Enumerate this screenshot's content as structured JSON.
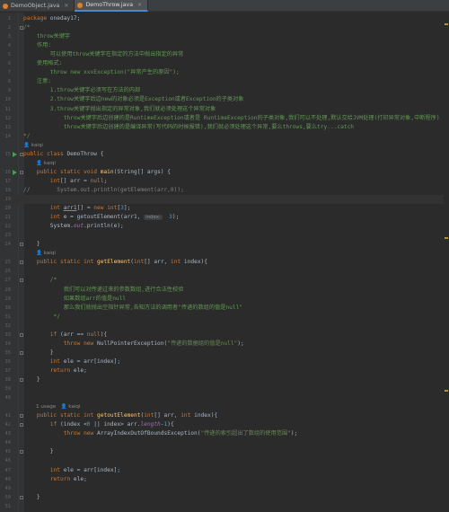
{
  "tabs": [
    {
      "label": "DemoObject.java",
      "active": false
    },
    {
      "label": "DemoThrow.java",
      "active": true
    }
  ],
  "colors": {
    "keyword": "#cc7832",
    "string": "#6a8759",
    "number": "#6897bb",
    "doc_comment": "#629755",
    "method": "#ffc66d",
    "field": "#9876aa"
  },
  "lines": [
    {
      "n": "1",
      "code": "package oneday17;"
    },
    {
      "n": "2",
      "code": "/*"
    },
    {
      "n": "3",
      "code": "    throw关键字"
    },
    {
      "n": "4",
      "code": "    作用:"
    },
    {
      "n": "5",
      "code": "        可以使用throw关键字在指定的方法中抛出指定的异常"
    },
    {
      "n": "6",
      "code": "    使用格式:"
    },
    {
      "n": "7",
      "code": "        throw new xxxException(\"异常产生的原因\");"
    },
    {
      "n": "8",
      "code": "    注意:"
    },
    {
      "n": "9",
      "code": "        1.throw关键字必须写在方法的内部"
    },
    {
      "n": "10",
      "code": "        2.throw关键字后边new的对象必须是Exception或者Exception的子类对象"
    },
    {
      "n": "11",
      "code": "        3.throw关键字抛出指定的异常对象,我们就必须处理这个异常对象"
    },
    {
      "n": "12",
      "code": "            throw关键字后边创建的是RuntimeException或者是 RuntimeException的子类对象,我们可以不处理,默认交给JVM处理(打印异常对象,中断程序)"
    },
    {
      "n": "13",
      "code": "            throw关键字后边创建的是编译异常(写代码的时候报错),我们就必须处理这个异常,要么throws,要么try...catch"
    },
    {
      "n": "14",
      "code": "*/"
    },
    {
      "n": "15",
      "code": "public class DemoThrow {"
    },
    {
      "n": "16",
      "code": "    public static void main(String[] args) {"
    },
    {
      "n": "17",
      "code": "        int[] arr = null;"
    },
    {
      "n": "18",
      "code": "//        System.out.println(getElement(arr,0));"
    },
    {
      "n": "19",
      "code": ""
    },
    {
      "n": "20",
      "code": "        int arr1[] = new int[3];"
    },
    {
      "n": "21",
      "code": "        int e = getoutElement(arr1,  3);"
    },
    {
      "n": "22",
      "code": "        System.out.println(e);"
    },
    {
      "n": "23",
      "code": ""
    },
    {
      "n": "24",
      "code": "    }"
    },
    {
      "n": "25",
      "code": "    public static int getElement(int[] arr, int index){"
    },
    {
      "n": "26",
      "code": ""
    },
    {
      "n": "27",
      "code": "        /*"
    },
    {
      "n": "28",
      "code": "            我们可以对传递过来的参数数组,进行合法性校验"
    },
    {
      "n": "29",
      "code": "            如果数组arr的值是null"
    },
    {
      "n": "30",
      "code": "            那么我们就抛出空指针异常,告知方法的调用者\"传递的数组的值是null\""
    },
    {
      "n": "31",
      "code": "         */"
    },
    {
      "n": "32",
      "code": ""
    },
    {
      "n": "33",
      "code": "        if (arr == null){"
    },
    {
      "n": "34",
      "code": "            throw new NullPointerException(\"传递的数据组的值是null\");"
    },
    {
      "n": "35",
      "code": "        }"
    },
    {
      "n": "36",
      "code": "        int ele = arr[index];"
    },
    {
      "n": "37",
      "code": "        return ele;"
    },
    {
      "n": "38",
      "code": "    }"
    },
    {
      "n": "39",
      "code": ""
    },
    {
      "n": "40",
      "code": ""
    },
    {
      "n": "41",
      "code": "    public static int getoutElement(int[] arr, int index){"
    },
    {
      "n": "42",
      "code": "        if (index <0 || index> arr.length-1){"
    },
    {
      "n": "43",
      "code": "            throw new ArrayIndexOutOfBoundsException(\"传递的索引超出了数组的使用范围\");"
    },
    {
      "n": "44",
      "code": ""
    },
    {
      "n": "45",
      "code": "        }"
    },
    {
      "n": "46",
      "code": ""
    },
    {
      "n": "47",
      "code": "        int ele = arr[index];"
    },
    {
      "n": "48",
      "code": "        return ele;"
    },
    {
      "n": "49",
      "code": ""
    },
    {
      "n": "50",
      "code": "    }"
    },
    {
      "n": "51",
      "code": ""
    },
    {
      "n": "52",
      "code": "}"
    }
  ],
  "hints": {
    "class_author": "kaiqi",
    "main_author": "kaiqi",
    "getElement_author": "kaiqi",
    "getoutElement_usage": "1 usage",
    "getoutElement_author": "kaiqi",
    "param_hint": "index:"
  }
}
